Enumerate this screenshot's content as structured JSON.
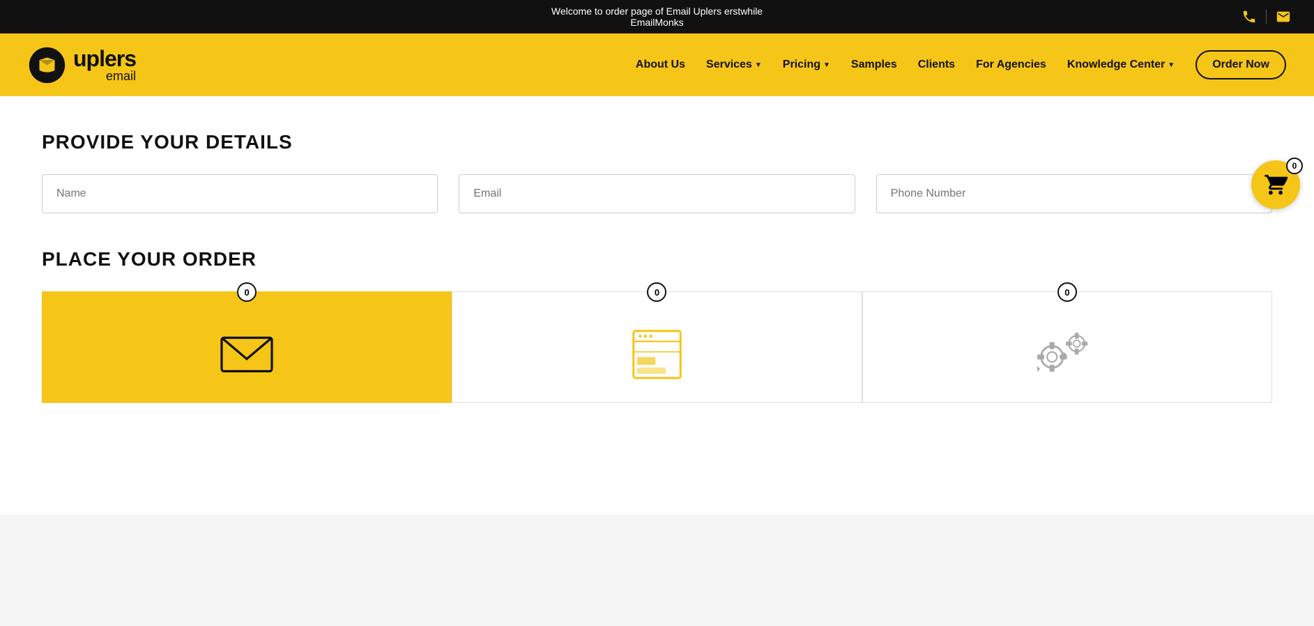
{
  "topBanner": {
    "text1": "Welcome to order page of Email Uplers erstwhile",
    "text2": "EmailMonks"
  },
  "header": {
    "siteUrl": "uplers.com",
    "logoUplers": "uplers",
    "logoEmail": "email",
    "nav": [
      {
        "id": "about",
        "label": "About Us",
        "hasDropdown": false
      },
      {
        "id": "services",
        "label": "Services",
        "hasDropdown": true
      },
      {
        "id": "pricing",
        "label": "Pricing",
        "hasDropdown": true
      },
      {
        "id": "samples",
        "label": "Samples",
        "hasDropdown": false
      },
      {
        "id": "clients",
        "label": "Clients",
        "hasDropdown": false
      },
      {
        "id": "for-agencies",
        "label": "For Agencies",
        "hasDropdown": false
      },
      {
        "id": "knowledge-center",
        "label": "Knowledge Center",
        "hasDropdown": true
      }
    ],
    "orderNowLabel": "Order Now"
  },
  "cart": {
    "count": "0"
  },
  "provideDetails": {
    "title": "PROVIDE YOUR DETAILS",
    "namePlaceholder": "Name",
    "emailPlaceholder": "Email",
    "phonePlaceholder": "Phone Number"
  },
  "placeOrder": {
    "title": "PLACE YOUR ORDER",
    "cards": [
      {
        "id": "email",
        "count": "0",
        "active": true
      },
      {
        "id": "template",
        "count": "0",
        "active": false
      },
      {
        "id": "automation",
        "count": "0",
        "active": false
      }
    ]
  },
  "colors": {
    "yellow": "#f5c518",
    "black": "#111111",
    "white": "#ffffff"
  }
}
